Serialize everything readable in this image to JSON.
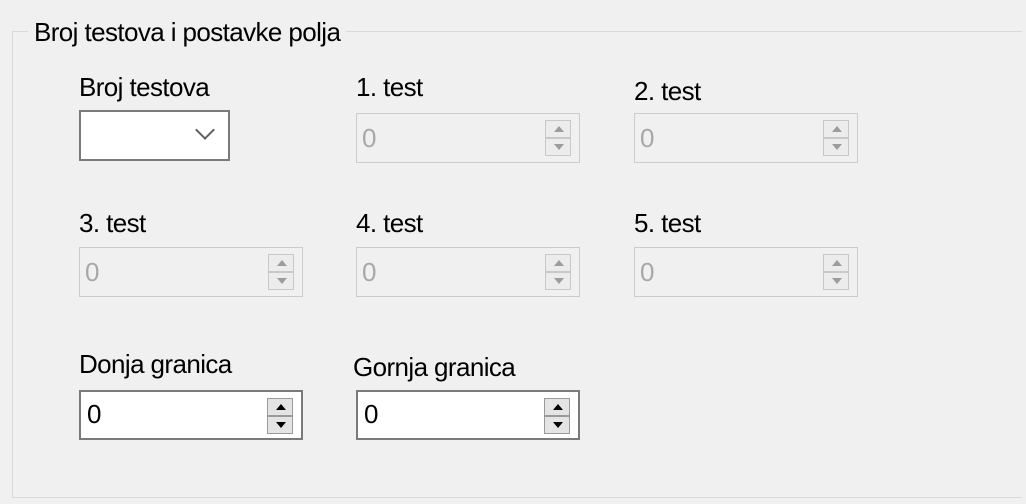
{
  "group": {
    "title": "Broj testova i postavke polja"
  },
  "test_count": {
    "label": "Broj testova",
    "value": "",
    "icon": "chevron-down-icon"
  },
  "tests": [
    {
      "label": "1. test",
      "value": "0",
      "enabled": false
    },
    {
      "label": "2. test",
      "value": "0",
      "enabled": false
    },
    {
      "label": "3. test",
      "value": "0",
      "enabled": false
    },
    {
      "label": "4. test",
      "value": "0",
      "enabled": false
    },
    {
      "label": "5. test",
      "value": "0",
      "enabled": false
    }
  ],
  "lower_bound": {
    "label": "Donja granica",
    "value": "0",
    "enabled": true
  },
  "upper_bound": {
    "label": "Gornja granica",
    "value": "0",
    "enabled": true
  },
  "colors": {
    "background": "#f0f0f0",
    "disabled_text": "#a8a8a8",
    "enabled_border": "#7a7a7a"
  }
}
